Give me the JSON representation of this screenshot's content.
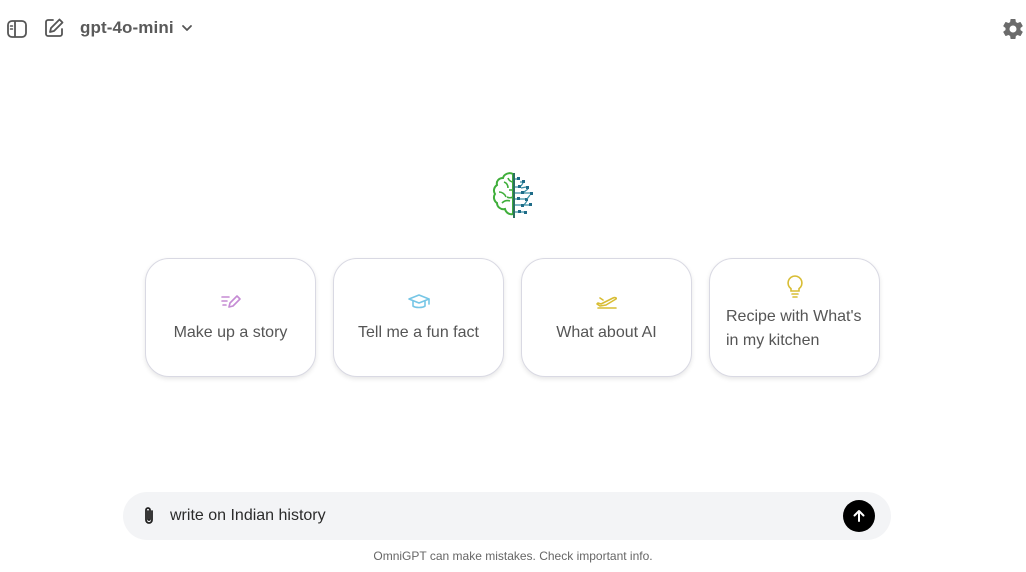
{
  "header": {
    "model_label": "gpt-4o-mini",
    "icons": {
      "sidebar": "sidebar-toggle-icon",
      "new_chat": "new-chat-icon",
      "dropdown": "chevron-down-icon",
      "settings": "gear-icon"
    }
  },
  "logo": {
    "icon": "brain-circuit-logo"
  },
  "suggestions": [
    {
      "label": "Make up a story",
      "icon": "pen-icon",
      "color": "#c58bd4"
    },
    {
      "label": "Tell me a fun fact",
      "icon": "graduation-cap-icon",
      "color": "#76c6e6"
    },
    {
      "label": "What about AI",
      "icon": "airplane-icon",
      "color": "#d8bd34"
    },
    {
      "label": "Recipe with What's in my kitchen",
      "icon": "lightbulb-icon",
      "color": "#d8bd34"
    }
  ],
  "composer": {
    "value": "write on Indian history",
    "icons": {
      "attach": "paperclip-icon",
      "send": "arrow-up-icon"
    }
  },
  "footer": {
    "disclaimer": "OmniGPT can make mistakes. Check important info."
  },
  "colors": {
    "send_button": "#000000",
    "composer_bg": "#f3f4f6",
    "card_border": "#d9d9e3"
  }
}
